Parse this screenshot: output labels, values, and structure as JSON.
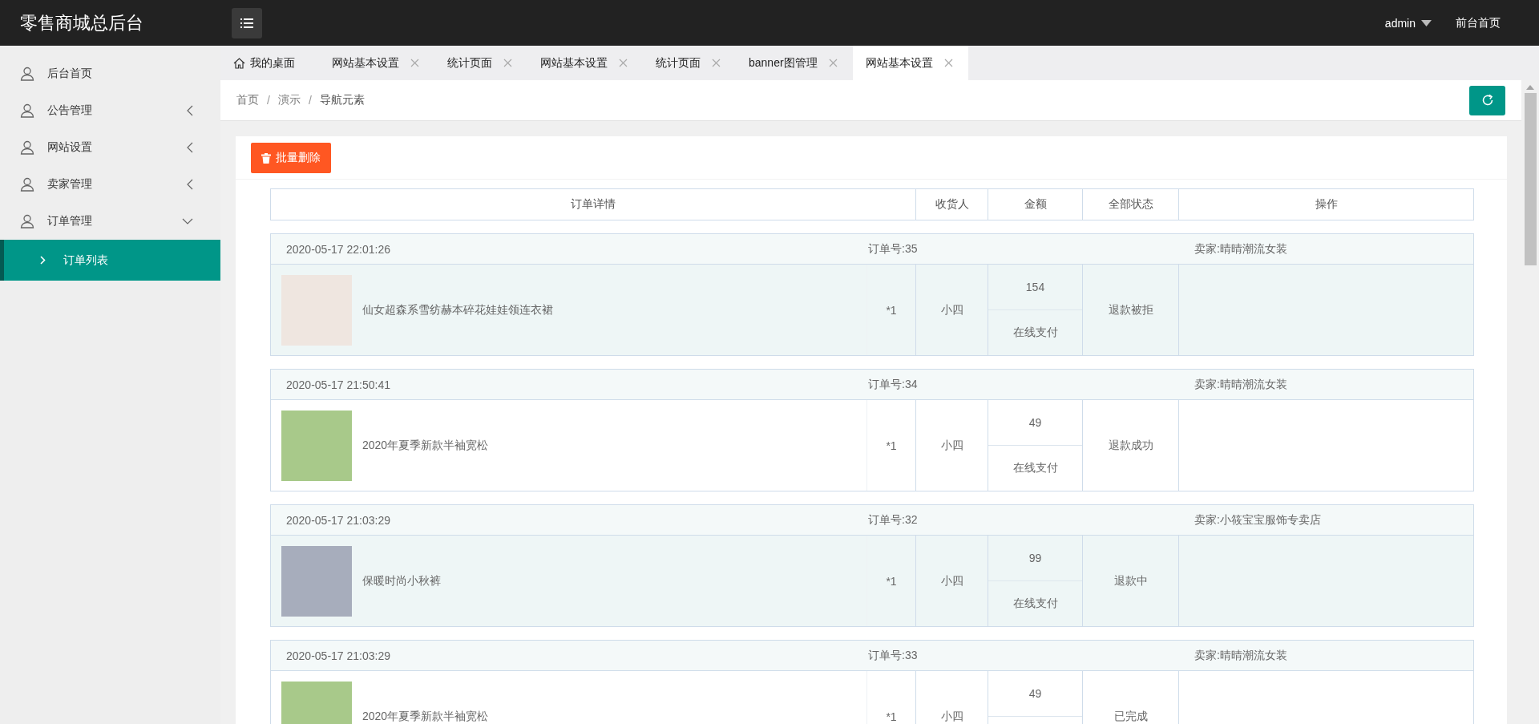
{
  "header": {
    "title": "零售商城总后台",
    "user": "admin",
    "home_link": "前台首页"
  },
  "sidebar": {
    "items": [
      {
        "label": "后台首页",
        "kind": "link",
        "selected": false
      },
      {
        "label": "公告管理",
        "kind": "group",
        "expanded": false,
        "selected": false
      },
      {
        "label": "网站设置",
        "kind": "group",
        "expanded": false,
        "selected": false
      },
      {
        "label": "卖家管理",
        "kind": "group",
        "expanded": false,
        "selected": false
      },
      {
        "label": "订单管理",
        "kind": "group",
        "expanded": true,
        "selected": false,
        "children": [
          {
            "label": "订单列表",
            "selected": true
          }
        ]
      }
    ]
  },
  "tabs": [
    {
      "label": "我的桌面",
      "kind": "home",
      "selected": false
    },
    {
      "label": "网站基本设置",
      "kind": "page",
      "selected": false
    },
    {
      "label": "统计页面",
      "kind": "page",
      "selected": false
    },
    {
      "label": "网站基本设置",
      "kind": "page",
      "selected": false
    },
    {
      "label": "统计页面",
      "kind": "page",
      "selected": false
    },
    {
      "label": "banner图管理",
      "kind": "page",
      "selected": false
    },
    {
      "label": "网站基本设置",
      "kind": "page",
      "selected": true
    }
  ],
  "breadcrumb": {
    "separator": "/",
    "items": [
      "首页",
      "演示",
      "导航元素"
    ]
  },
  "toolbar": {
    "delete_button": "批量删除"
  },
  "table": {
    "columns": [
      "订单详情",
      "收货人",
      "金额",
      "全部状态",
      "操作"
    ],
    "orders": [
      {
        "date": "2020-05-17 22:01:26",
        "order_no": "订单号:35",
        "seller": "卖家:晴晴潮流女装",
        "product": "仙女超森系雪纺赫本碎花娃娃领连衣裙",
        "qty": "*1",
        "receiver": "小四",
        "amount": "154",
        "payment": "在线支付",
        "status": "退款被拒",
        "highlighted": true
      },
      {
        "date": "2020-05-17 21:50:41",
        "order_no": "订单号:34",
        "seller": "卖家:晴晴潮流女装",
        "product": "2020年夏季新款半袖宽松",
        "qty": "*1",
        "receiver": "小四",
        "amount": "49",
        "payment": "在线支付",
        "status": "退款成功",
        "highlighted": false
      },
      {
        "date": "2020-05-17 21:03:29",
        "order_no": "订单号:32",
        "seller": "卖家:小筱宝宝服饰专卖店",
        "product": "保暖时尚小秋裤",
        "qty": "*1",
        "receiver": "小四",
        "amount": "99",
        "payment": "在线支付",
        "status": "退款中",
        "highlighted": true
      },
      {
        "date": "2020-05-17 21:03:29",
        "order_no": "订单号:33",
        "seller": "卖家:晴晴潮流女装",
        "product": "2020年夏季新款半袖宽松",
        "qty": "*1",
        "receiver": "小四",
        "amount": "49",
        "status": "已完成",
        "highlighted": false
      }
    ]
  }
}
